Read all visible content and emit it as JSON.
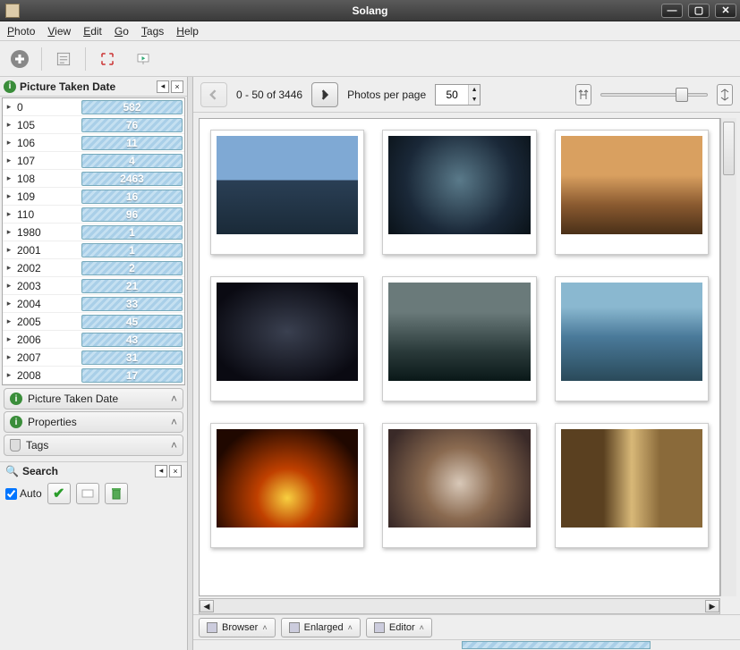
{
  "window": {
    "title": "Solang"
  },
  "menu": {
    "items": [
      "Photo",
      "View",
      "Edit",
      "Go",
      "Tags",
      "Help"
    ]
  },
  "sidebar": {
    "header": "Picture Taken Date",
    "rows": [
      {
        "key": "0",
        "val": "582"
      },
      {
        "key": "105",
        "val": "76"
      },
      {
        "key": "106",
        "val": "11"
      },
      {
        "key": "107",
        "val": "4"
      },
      {
        "key": "108",
        "val": "2463"
      },
      {
        "key": "109",
        "val": "16"
      },
      {
        "key": "110",
        "val": "96"
      },
      {
        "key": "1980",
        "val": "1"
      },
      {
        "key": "2001",
        "val": "1"
      },
      {
        "key": "2002",
        "val": "2"
      },
      {
        "key": "2003",
        "val": "21"
      },
      {
        "key": "2004",
        "val": "33"
      },
      {
        "key": "2005",
        "val": "45"
      },
      {
        "key": "2006",
        "val": "43"
      },
      {
        "key": "2007",
        "val": "31"
      },
      {
        "key": "2008",
        "val": "17"
      }
    ],
    "expanders": [
      {
        "label": "Picture Taken Date",
        "icon": "info"
      },
      {
        "label": "Properties",
        "icon": "info"
      },
      {
        "label": "Tags",
        "icon": "tag"
      }
    ],
    "search": {
      "label": "Search",
      "auto_label": "Auto"
    }
  },
  "pager": {
    "range": "0 - 50 of 3446",
    "per_page_label": "Photos per page",
    "per_page_value": "50"
  },
  "tabs": {
    "browser": "Browser",
    "enlarged": "Enlarged",
    "editor": "Editor"
  }
}
